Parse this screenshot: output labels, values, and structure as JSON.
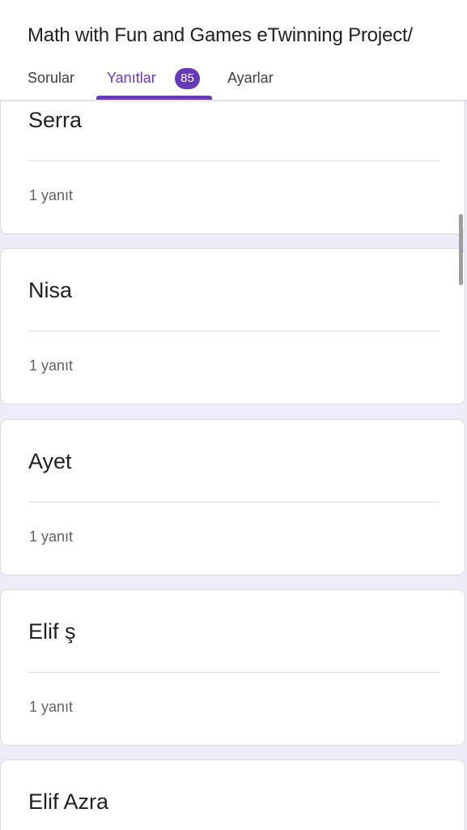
{
  "header": {
    "form_title": "Math with Fun and Games eTwinning Project/",
    "tabs": [
      {
        "label": "Sorular"
      },
      {
        "label": "Yanıtlar",
        "badge": "85"
      },
      {
        "label": "Ayarlar"
      }
    ],
    "active_tab": "Yanıtlar"
  },
  "responses": [
    {
      "name": "Serra",
      "count": "1 yanıt"
    },
    {
      "name": "Nisa",
      "count": "1 yanıt"
    },
    {
      "name": "Ayet",
      "count": "1 yanıt"
    },
    {
      "name": "Elif ş",
      "count": "1 yanıt"
    },
    {
      "name": "Elif Azra"
    }
  ],
  "colors": {
    "accent": "#673ab7",
    "background": "#f0ebf8",
    "card": "#ffffff",
    "divider": "#dadce0"
  }
}
